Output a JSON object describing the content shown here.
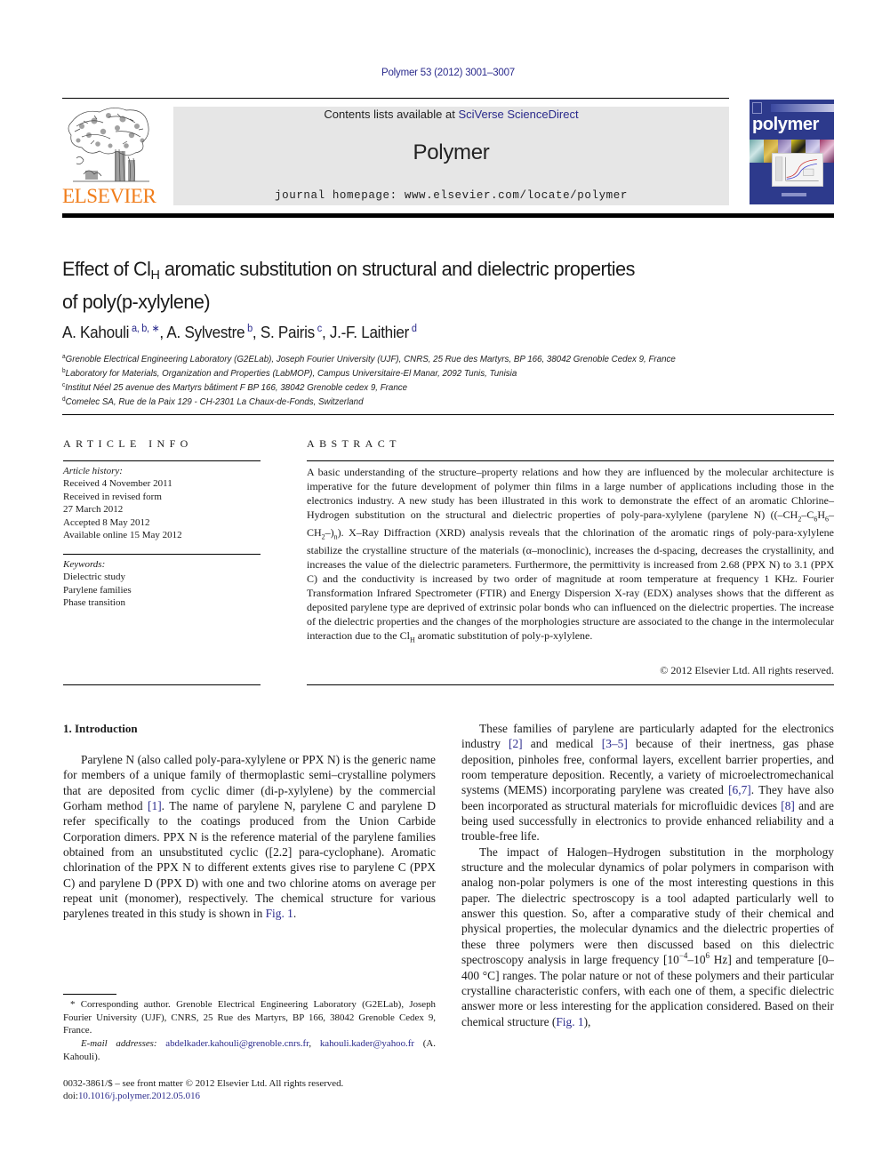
{
  "header": {
    "citation": "Polymer 53 (2012) 3001–3007",
    "contents_prefix": "Contents lists available at ",
    "contents_link": "SciVerse ScienceDirect",
    "journal_name": "Polymer",
    "homepage_prefix": "journal homepage: ",
    "homepage_url": "www.elsevier.com/locate/polymer",
    "publisher_logo_text": "ELSEVIER",
    "cover_title": "polymer",
    "colors": {
      "publisher_orange": "#f07d1b",
      "cover_blue": "#2d3a8c",
      "link_blue": "#2a2a8c",
      "banner_gray": "#e6e6e6"
    }
  },
  "article": {
    "title_part1": "Effect of Cl",
    "title_sub": "H",
    "title_part2": " aromatic substitution on structural and dielectric properties",
    "title_line2": "of poly(p-xylylene)",
    "authors": [
      {
        "name": "A. Kahouli",
        "marks": "a, b, ∗",
        "sep": ", "
      },
      {
        "name": "A. Sylvestre",
        "marks": "b",
        "sep": ", "
      },
      {
        "name": "S. Pairis",
        "marks": "c",
        "sep": ", "
      },
      {
        "name": "J.-F. Laithier",
        "marks": "d",
        "sep": ""
      }
    ],
    "affiliations": [
      {
        "mark": "a",
        "text": "Grenoble Electrical Engineering Laboratory (G2ELab), Joseph Fourier University (UJF), CNRS, 25 Rue des Martyrs, BP 166, 38042 Grenoble Cedex 9, France"
      },
      {
        "mark": "b",
        "text": "Laboratory for Materials, Organization and Properties (LabMOP), Campus Universitaire-El Manar, 2092 Tunis, Tunisia"
      },
      {
        "mark": "c",
        "text": "Institut Néel 25 avenue des Martyrs bâtiment F BP 166, 38042 Grenoble cedex 9, France"
      },
      {
        "mark": "d",
        "text": "Comelec SA, Rue de la Paix 129 - CH-2301 La Chaux-de-Fonds, Switzerland"
      }
    ]
  },
  "article_info": {
    "label": "ARTICLE INFO",
    "history_heading": "Article history:",
    "history": [
      "Received 4 November 2011",
      "Received in revised form",
      "27 March 2012",
      "Accepted 8 May 2012",
      "Available online 15 May 2012"
    ],
    "keywords_heading": "Keywords:",
    "keywords": [
      "Dielectric study",
      "Parylene families",
      "Phase transition"
    ]
  },
  "abstract": {
    "label": "ABSTRACT",
    "text_1": "A basic understanding of the structure–property relations and how they are influenced by the molecular architecture is imperative for the future development of polymer thin films in a large number of applications including those in the electronics industry. A new study has been illustrated in this work to demonstrate the effect of an aromatic Chlorine–Hydrogen substitution on the structural and dielectric properties of poly-para-xylylene (parylene N) ((–CH",
    "f_sub1": "2",
    "f_mid1": "–C",
    "f_sub2": "6",
    "f_mid2": "H",
    "f_sub3": "6",
    "f_mid3": "–CH",
    "f_sub4": "2",
    "f_mid4": "–)",
    "f_sub5": "n",
    "text_2": "). X–Ray Diffraction (XRD) analysis reveals that the chlorination of the aromatic rings of poly-para-xylylene stabilize the crystalline structure of the materials (α–monoclinic), increases the d-spacing, decreases the crystallinity, and increases the value of the dielectric parameters. Furthermore, the permittivity is increased from 2.68 (PPX N) to 3.1 (PPX C) and the conductivity is increased by two order of magnitude at room temperature at frequency 1 KHz. Fourier Transformation Infrared Spectrometer (FTIR) and Energy Dispersion X-ray (EDX) analyses shows that the different as deposited parylene type are deprived of extrinsic polar bonds who can influenced on the dielectric properties. The increase of the dielectric properties and the changes of the morphologies structure are associated to the change in the intermolecular interaction due to the Cl",
    "text_2_sub": "H",
    "text_3": " aromatic substitution of poly-p-xylylene.",
    "copyright": "© 2012 Elsevier Ltd. All rights reserved."
  },
  "introduction": {
    "heading": "1.  Introduction",
    "left_p1_a": "Parylene N (also called poly-para-xylylene or PPX N) is the generic name for members of a unique family of thermoplastic semi–crystalline polymers that are deposited from cyclic dimer (di-p-xylylene) by the commercial Gorham method ",
    "ref_1": "[1]",
    "left_p1_b": ". The name of parylene N, parylene C and parylene D refer specifically to the coatings produced from the Union Carbide Corporation dimers. PPX N is the reference material of the parylene families obtained from an unsubstituted cyclic ([2.2] para-cyclophane). Aromatic chlorination of the PPX N to different extents gives rise to parylene C (PPX C) and parylene D (PPX D) with one and two chlorine atoms on average per repeat unit (monomer), respectively. The chemical structure for various parylenes treated in this study is shown in ",
    "fig_1": "Fig. 1",
    "left_p1_c": ".",
    "right_p1_a": "These families of parylene are particularly adapted for the electronics industry ",
    "ref_2": "[2]",
    "right_p1_b": " and medical ",
    "ref_3_5": "[3–5]",
    "right_p1_c": " because of their inertness, gas phase deposition, pinholes free, conformal layers, excellent barrier properties, and room temperature deposition. Recently, a variety of microelectromechanical systems (MEMS) incorporating parylene was created ",
    "ref_6_7": "[6,7]",
    "right_p1_d": ". They have also been incorporated as structural materials for microfluidic devices ",
    "ref_8": "[8]",
    "right_p1_e": " and are being used successfully in electronics to provide enhanced reliability and a trouble-free life.",
    "right_p2_a": "The impact of Halogen–Hydrogen substitution in the morphology structure and the molecular dynamics of polar polymers in comparison with analog non-polar polymers is one of the most interesting questions in this paper. The dielectric spectroscopy is a tool adapted particularly well to answer this question. So, after a comparative study of their chemical and physical properties, the molecular dynamics and the dielectric properties of these three polymers were then discussed based on this dielectric spectroscopy analysis in large frequency [10",
    "sup_minus4": "−4",
    "dash": "–10",
    "sup_6": "6",
    "right_p2_b": " Hz] and temperature [0–400 °C] ranges. The polar nature or not of these polymers and their particular crystalline characteristic confers, with each one of them, a specific dielectric answer more or less interesting for the application considered. Based on their chemical structure (",
    "fig_1_b": "Fig. 1",
    "right_p2_c": "),"
  },
  "footnote": {
    "corresponding": "* Corresponding author. Grenoble Electrical Engineering Laboratory (G2ELab), Joseph Fourier University (UJF), CNRS, 25 Rue des Martyrs, BP 166, 38042 Grenoble Cedex 9, France.",
    "email_label": "E-mail addresses:",
    "email_1": "abdelkader.kahouli@grenoble.cnrs.fr",
    "email_sep": ", ",
    "email_2": "kahouli.kader@yahoo.fr",
    "email_owner": "(A. Kahouli)."
  },
  "front_matter": {
    "issn_line": "0032-3861/$ – see front matter © 2012 Elsevier Ltd. All rights reserved.",
    "doi_prefix": "doi:",
    "doi": "10.1016/j.polymer.2012.05.016"
  }
}
